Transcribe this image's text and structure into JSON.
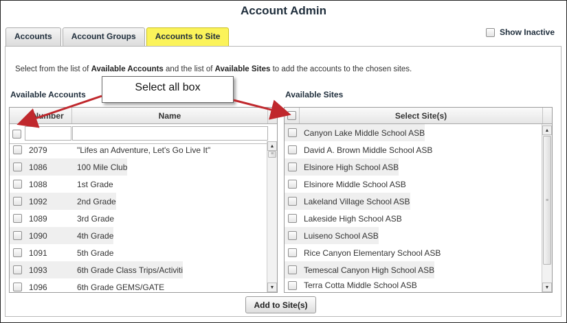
{
  "page_title": "Account Admin",
  "tabs": [
    {
      "label": "Accounts",
      "active": false
    },
    {
      "label": "Account Groups",
      "active": false
    },
    {
      "label": "Accounts to Site",
      "active": true
    }
  ],
  "show_inactive": {
    "label": "Show Inactive",
    "checked": false
  },
  "instructions": {
    "part1": "Select from the list of ",
    "bold1": "Available Accounts",
    "part2": " and the list of ",
    "bold2": "Available Sites",
    "part3": " to add the accounts to the chosen sites."
  },
  "accounts": {
    "heading": "Available Accounts",
    "columns": {
      "number": "Number",
      "name": "Name"
    },
    "filter": {
      "number": "",
      "name": ""
    },
    "rows": [
      {
        "number": "2079",
        "name": "\"Lifes an Adventure, Let's Go Live It\""
      },
      {
        "number": "1086",
        "name": "100 Mile Club"
      },
      {
        "number": "1088",
        "name": "1st Grade"
      },
      {
        "number": "1092",
        "name": "2nd Grade"
      },
      {
        "number": "1089",
        "name": "3rd Grade"
      },
      {
        "number": "1090",
        "name": "4th Grade"
      },
      {
        "number": "1091",
        "name": "5th Grade"
      },
      {
        "number": "1093",
        "name": "6th Grade Class Trips/Activiti"
      },
      {
        "number": "1096",
        "name": "6th Grade GEMS/GATE"
      }
    ]
  },
  "sites": {
    "heading": "Available Sites",
    "column": "Select Site(s)",
    "rows": [
      "Canyon Lake Middle School ASB",
      "David A. Brown Middle School ASB",
      "Elsinore High School ASB",
      "Elsinore Middle School ASB",
      "Lakeland Village School ASB",
      "Lakeside High School ASB",
      "Luiseno School ASB",
      "Rice Canyon Elementary School ASB",
      "Temescal Canyon High School ASB",
      "Terra Cotta Middle School ASB"
    ]
  },
  "callout": "Select all box",
  "add_button": "Add to Site(s)",
  "colors": {
    "active_tab": "#fbf35a",
    "arrow": "#c0282d",
    "title": "#1e2d3b"
  },
  "icons": {
    "scroll_up": "▲",
    "scroll_down": "▼",
    "grip": "≡"
  }
}
